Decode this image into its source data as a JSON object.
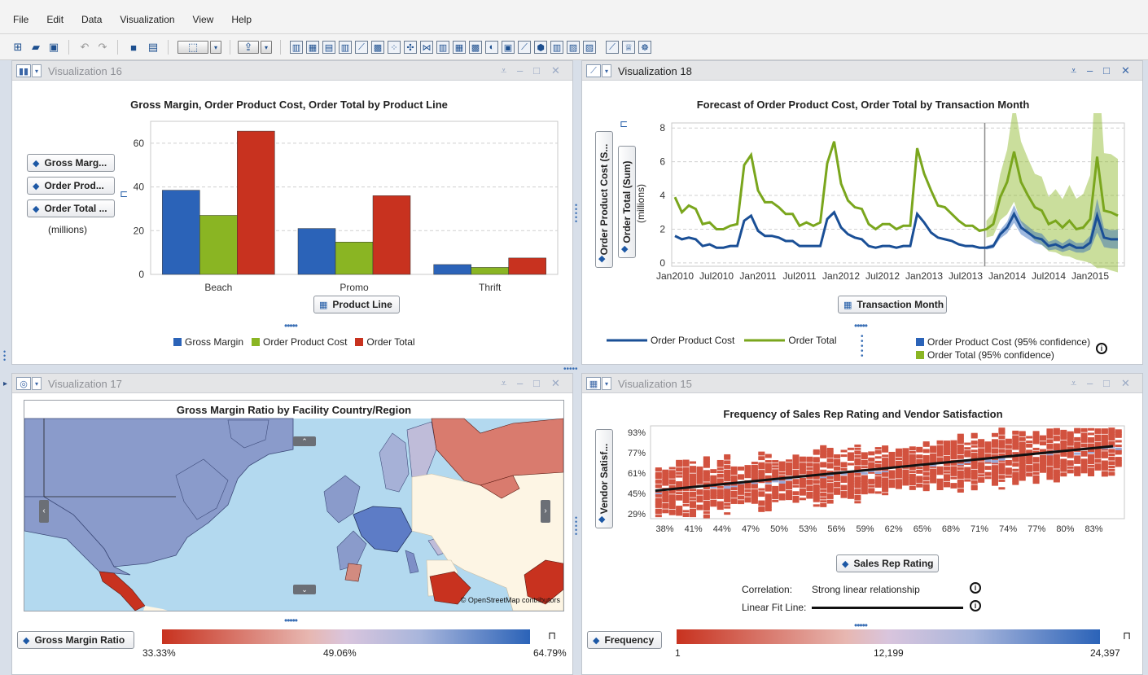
{
  "menu": [
    "File",
    "Edit",
    "Data",
    "Visualization",
    "View",
    "Help"
  ],
  "panels": {
    "v16": {
      "tab_title": "Visualization 16",
      "chart_title": "Gross Margin, Order Product Cost, Order Total by Product Line",
      "measures": [
        "Gross Marg...",
        "Order Prod...",
        "Order Total ..."
      ],
      "units": "(millions)",
      "x_button": "Product Line",
      "legend": [
        "Gross Margin",
        "Order Product Cost",
        "Order Total"
      ]
    },
    "v18": {
      "tab_title": "Visualization 18",
      "chart_title": "Forecast of Order Product Cost, Order Total by Transaction Month",
      "y_buttons": [
        "Order Product Cost (S...",
        "Order Total (Sum)"
      ],
      "units": "(millions)",
      "x_button": "Transaction Month",
      "legend": [
        "Order Product Cost",
        "Order Total",
        "Order Product Cost (95% confidence)",
        "Order Total (95% confidence)"
      ]
    },
    "v17": {
      "tab_title": "Visualization 17",
      "chart_title": "Gross Margin Ratio by Facility Country/Region",
      "attribution": "© OpenStreetMap contributors",
      "color_button": "Gross Margin Ratio",
      "scale": [
        "33.33%",
        "49.06%",
        "64.79%"
      ]
    },
    "v15": {
      "tab_title": "Visualization 15",
      "chart_title": "Frequency of Sales Rep Rating and Vendor Satisfaction",
      "y_button": "Vendor Satisf...",
      "x_button": "Sales Rep Rating",
      "correlation_label": "Correlation:",
      "correlation_value": "Strong linear relationship",
      "fit_label": "Linear Fit Line:",
      "color_button": "Frequency",
      "scale": [
        "1",
        "12,199",
        "24,397"
      ]
    }
  },
  "colors": {
    "blue": "#2b63b8",
    "green": "#8ab523",
    "red": "#c8321f"
  },
  "chart_data": [
    {
      "type": "bar",
      "title": "Gross Margin, Order Product Cost, Order Total by Product Line",
      "categories": [
        "Beach",
        "Promo",
        "Thrift"
      ],
      "series": [
        {
          "name": "Gross Margin",
          "values": [
            38.5,
            21,
            4.5
          ]
        },
        {
          "name": "Order Product Cost",
          "values": [
            27,
            14.8,
            3.2
          ]
        },
        {
          "name": "Order Total",
          "values": [
            65.5,
            36,
            7.5
          ]
        }
      ],
      "ylabel": "(millions)",
      "yticks": [
        "0",
        "20",
        "40",
        "60"
      ],
      "ylim": [
        0,
        70
      ],
      "legend": "bottom"
    },
    {
      "type": "line",
      "title": "Forecast of Order Product Cost, Order Total by Transaction Month",
      "x": [
        "2010-01",
        "2010-02",
        "2010-03",
        "2010-04",
        "2010-05",
        "2010-06",
        "2010-07",
        "2010-08",
        "2010-09",
        "2010-10",
        "2010-11",
        "2010-12",
        "2011-01",
        "2011-02",
        "2011-03",
        "2011-04",
        "2011-05",
        "2011-06",
        "2011-07",
        "2011-08",
        "2011-09",
        "2011-10",
        "2011-11",
        "2011-12",
        "2012-01",
        "2012-02",
        "2012-03",
        "2012-04",
        "2012-05",
        "2012-06",
        "2012-07",
        "2012-08",
        "2012-09",
        "2012-10",
        "2012-11",
        "2012-12",
        "2013-01",
        "2013-02",
        "2013-03",
        "2013-04",
        "2013-05",
        "2013-06",
        "2013-07",
        "2013-08",
        "2013-09",
        "2013-10",
        "2013-11",
        "2013-12",
        "2014-01",
        "2014-02",
        "2014-03",
        "2014-04",
        "2014-05",
        "2014-06",
        "2014-07",
        "2014-08",
        "2014-09",
        "2014-10",
        "2014-11",
        "2014-12",
        "2015-01",
        "2015-02",
        "2015-03",
        "2015-04",
        "2015-05"
      ],
      "xticks": [
        "Jan2010",
        "Jul2010",
        "Jan2011",
        "Jul2011",
        "Jan2012",
        "Jul2012",
        "Jan2013",
        "Jul2013",
        "Jan2014",
        "Jul2014",
        "Jan2015"
      ],
      "yticks": [
        "0",
        "2",
        "4",
        "6",
        "8"
      ],
      "series": [
        {
          "name": "Order Total",
          "values": [
            3.9,
            3.0,
            3.4,
            3.2,
            2.3,
            2.4,
            2.0,
            2.0,
            2.2,
            2.3,
            5.8,
            6.4,
            4.3,
            3.6,
            3.6,
            3.3,
            2.9,
            2.9,
            2.2,
            2.4,
            2.2,
            2.4,
            5.9,
            7.2,
            4.7,
            3.7,
            3.3,
            3.2,
            2.3,
            2.0,
            2.3,
            2.3,
            2.0,
            2.2,
            2.2,
            6.8,
            5.3,
            4.3,
            3.4,
            3.3,
            2.9,
            2.5,
            2.2,
            2.2,
            1.9,
            2.0,
            2.3,
            3.9,
            4.8,
            6.6,
            4.8,
            4.0,
            3.3,
            3.1,
            2.3,
            2.5,
            2.1,
            2.5,
            2.0,
            2.1,
            2.6,
            6.3,
            3.1,
            3.0,
            2.8
          ]
        },
        {
          "name": "Order Product Cost",
          "values": [
            1.6,
            1.4,
            1.5,
            1.4,
            1.0,
            1.1,
            0.9,
            0.9,
            1.0,
            1.0,
            2.5,
            2.8,
            1.9,
            1.6,
            1.6,
            1.5,
            1.3,
            1.3,
            1.0,
            1.0,
            1.0,
            1.0,
            2.6,
            3.0,
            2.1,
            1.7,
            1.5,
            1.4,
            1.0,
            0.9,
            1.0,
            1.0,
            0.9,
            1.0,
            1.0,
            2.9,
            2.4,
            1.8,
            1.5,
            1.4,
            1.3,
            1.1,
            1.0,
            1.0,
            0.9,
            0.9,
            1.0,
            1.7,
            2.1,
            2.9,
            2.1,
            1.8,
            1.5,
            1.4,
            1.0,
            1.1,
            0.9,
            1.1,
            0.9,
            0.9,
            1.2,
            2.8,
            1.5,
            1.4,
            1.4
          ]
        }
      ],
      "forecast_start": "2013-10",
      "ylabel": "(millions)"
    },
    {
      "type": "heatmap",
      "title": "Frequency of Sales Rep Rating and Vendor Satisfaction",
      "xticks": [
        "38%",
        "41%",
        "44%",
        "47%",
        "50%",
        "53%",
        "56%",
        "59%",
        "62%",
        "65%",
        "68%",
        "71%",
        "74%",
        "77%",
        "80%",
        "83%"
      ],
      "yticks": [
        "29%",
        "45%",
        "61%",
        "77%",
        "93%"
      ],
      "fit_line": {
        "x": [
          0.37,
          0.85
        ],
        "y": [
          0.47,
          0.82
        ]
      }
    }
  ]
}
